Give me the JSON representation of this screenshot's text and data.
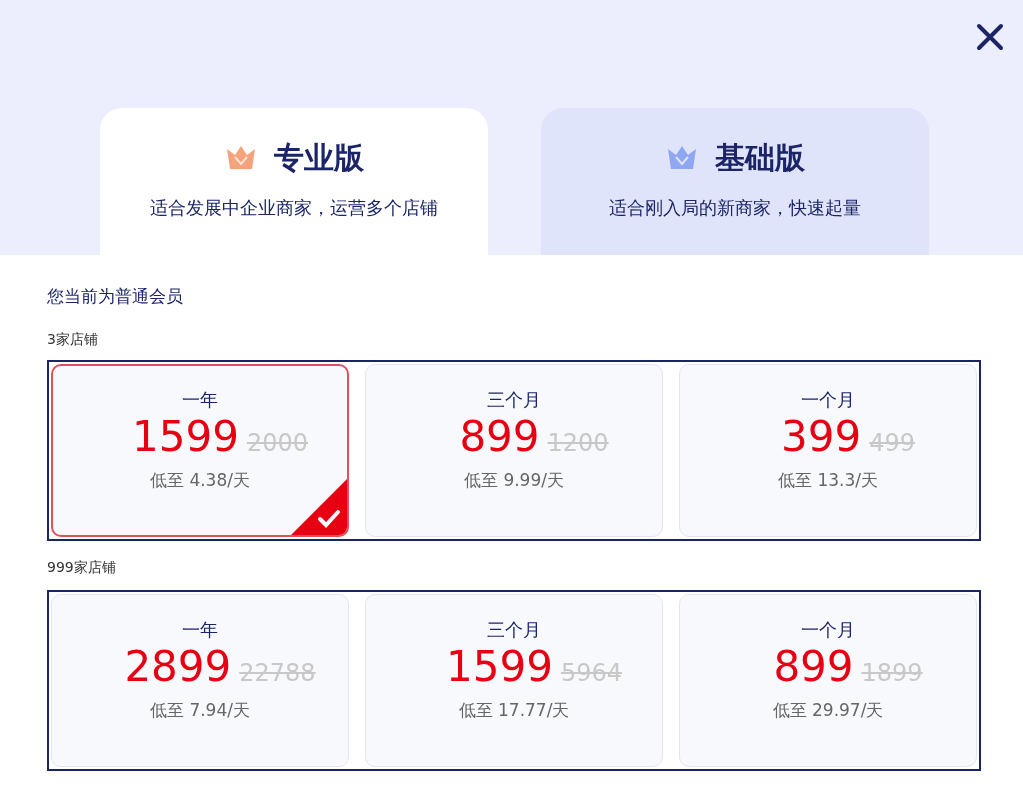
{
  "tabs": [
    {
      "title": "专业版",
      "subtitle": "适合发展中企业商家，运营多个店铺",
      "selected": true,
      "color": "#f4a47c"
    },
    {
      "title": "基础版",
      "subtitle": "适合刚入局的新商家，快速起量",
      "selected": false,
      "color": "#8fa6f0"
    }
  ],
  "member_status": "您当前为普通会员",
  "groups": [
    {
      "label": "3家店铺",
      "plans": [
        {
          "period": "一年",
          "price": "1599",
          "original_price": "2000",
          "per_day": "低至 4.38/天",
          "selected": true
        },
        {
          "period": "三个月",
          "price": "899",
          "original_price": "1200",
          "per_day": "低至 9.99/天",
          "selected": false
        },
        {
          "period": "一个月",
          "price": "399",
          "original_price": "499",
          "per_day": "低至 13.3/天",
          "selected": false
        }
      ]
    },
    {
      "label": "999家店铺",
      "plans": [
        {
          "period": "一年",
          "price": "2899",
          "original_price": "22788",
          "per_day": "低至 7.94/天",
          "selected": false
        },
        {
          "period": "三个月",
          "price": "1599",
          "original_price": "5964",
          "per_day": "低至 17.77/天",
          "selected": false
        },
        {
          "period": "一个月",
          "price": "899",
          "original_price": "1899",
          "per_day": "低至 29.97/天",
          "selected": false
        }
      ]
    }
  ]
}
